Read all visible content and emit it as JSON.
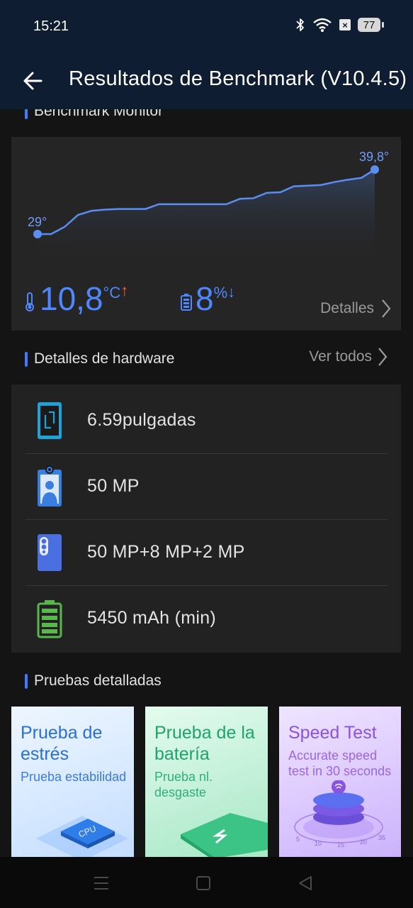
{
  "status_bar": {
    "time": "15:21",
    "battery_level": "77",
    "icons": [
      "bluetooth-icon",
      "wifi-icon",
      "data-off-icon",
      "battery-icon"
    ]
  },
  "header": {
    "title": "Resultados de Benchmark (V10.4.5)",
    "back_icon": "arrow-left-icon"
  },
  "monitor": {
    "section_title": "Benchmark Monitor",
    "temp_start_label": "29°",
    "temp_end_label": "39,8°",
    "temp_rise_value": "10,8",
    "temp_rise_unit": "°C",
    "battery_drop_value": "8",
    "battery_drop_unit": "%",
    "details_label": "Detalles",
    "line_color": "#5b8ef0",
    "chart_data": {
      "type": "area",
      "x": [
        0,
        1,
        2,
        3,
        4,
        5,
        6,
        7,
        8,
        9,
        10,
        11,
        12,
        13,
        14,
        15,
        16,
        17,
        18,
        19,
        20,
        21,
        22,
        23,
        24,
        25
      ],
      "values": [
        29.0,
        29.0,
        30.2,
        32.2,
        32.9,
        33.1,
        33.2,
        33.2,
        33.2,
        34.0,
        34.0,
        34.0,
        34.0,
        34.0,
        34.0,
        34.9,
        35.0,
        35.9,
        36.0,
        37.0,
        37.1,
        37.2,
        37.7,
        38.1,
        38.4,
        39.8
      ],
      "ylim": [
        29,
        39.8
      ],
      "grid": false
    }
  },
  "hardware": {
    "section_title": "Detalles de hardware",
    "view_all_label": "Ver todos",
    "items": [
      {
        "icon": "screen-size-icon",
        "text": "6.59pulgadas"
      },
      {
        "icon": "front-camera-icon",
        "text": "50 MP"
      },
      {
        "icon": "rear-camera-icon",
        "text": "50 MP+8 MP+2 MP"
      },
      {
        "icon": "battery-capacity-icon",
        "text": "5450 mAh (min)"
      }
    ]
  },
  "tests": {
    "section_title": "Pruebas detalladas",
    "cards": [
      {
        "title": "Prueba de estrés",
        "subtitle": "Prueba estabilidad",
        "icon": "cpu-chip-icon",
        "chip_text": "CPU"
      },
      {
        "title": "Prueba de la batería",
        "subtitle_line1": "Prueba nl.",
        "subtitle_line2": "desgaste",
        "icon": "battery-charging-icon"
      },
      {
        "title": "Speed Test",
        "subtitle_line1": "Accurate speed",
        "subtitle_line2": "test in 30 seconds",
        "icon": "speed-dial-icon",
        "dial_ticks": [
          "5",
          "10",
          "15",
          "20",
          "35"
        ]
      }
    ]
  },
  "nav_bar": {
    "icons": [
      "menu-icon",
      "home-icon",
      "back-triangle-icon"
    ]
  }
}
